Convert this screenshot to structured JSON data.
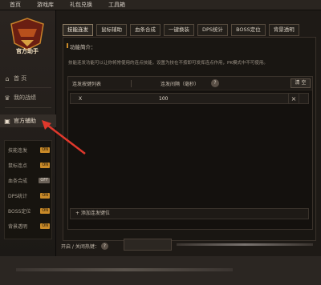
{
  "topbar": {
    "items": [
      "首页",
      "游戏库",
      "礼包兑换",
      "工具箱"
    ]
  },
  "sidebar": {
    "logo_text": "官方助手",
    "nav": [
      {
        "label": "首 页",
        "icon": "home-icon"
      },
      {
        "label": "我的战绩",
        "icon": "trophy-icon"
      },
      {
        "label": "官方辅助",
        "icon": "briefcase-icon"
      }
    ],
    "sub_items": [
      {
        "label": "技能连发",
        "badge": "ON"
      },
      {
        "label": "鼠标连点",
        "badge": "ON"
      },
      {
        "label": "血条合成",
        "badge": "OFF"
      },
      {
        "label": "DPS统计",
        "badge": "ON"
      },
      {
        "label": "BOSS定位",
        "badge": "ON"
      },
      {
        "label": "背景透明",
        "badge": "ON"
      }
    ]
  },
  "main": {
    "tabs": [
      "技能连发",
      "鼠标辅助",
      "血条合成",
      "一键换装",
      "DPS统计",
      "BOSS定位",
      "背景透明"
    ],
    "active_tab": "技能连发",
    "section_title": "功能简介：",
    "description": "技能连发功能可以让你将常使用的连点技能，设置为技在不按即可发挥连点作用，PK模式中不可使用。",
    "grid": {
      "col1": "连发按键列表",
      "col2": "连发间隔（毫秒）",
      "help": "?",
      "clear_label": "清 空",
      "rows": [
        {
          "key": "X",
          "interval": "100"
        }
      ],
      "row_delete": "×",
      "add_label": "+ 添加连发键位"
    },
    "hotkey_label": "开启 / 关闭热键：",
    "hotkey_help": "?"
  },
  "colors": {
    "accent": "#c98a28",
    "arrow": "#e0382c"
  }
}
